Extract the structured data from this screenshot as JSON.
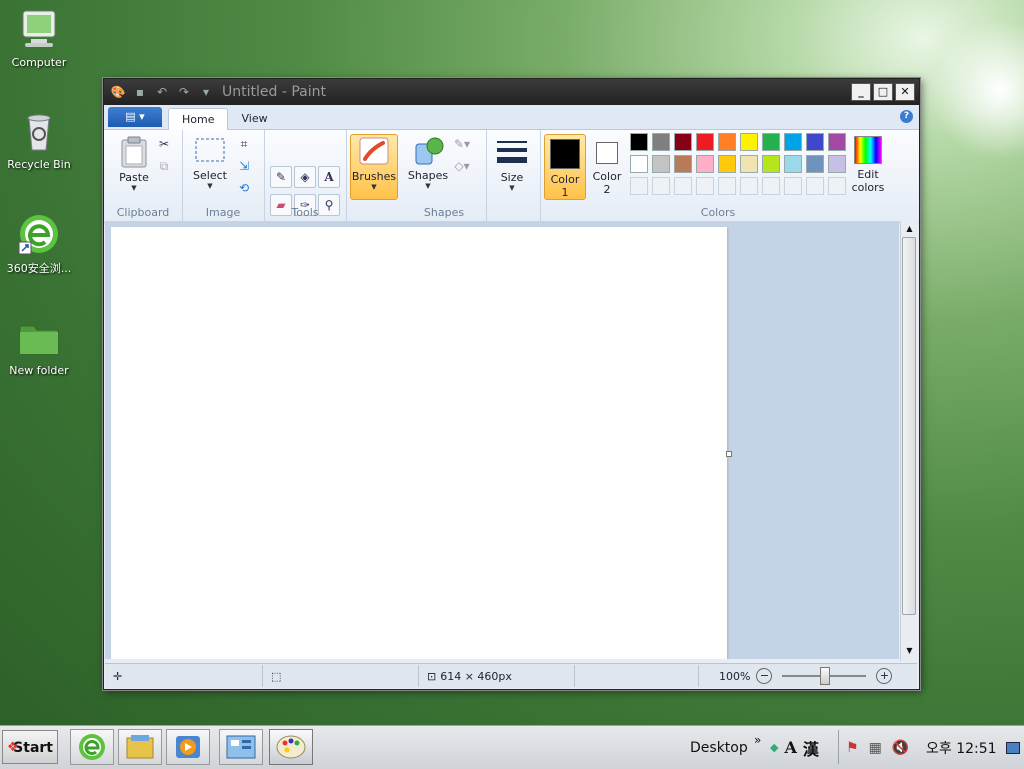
{
  "desktop": {
    "icons": [
      {
        "label": "Computer"
      },
      {
        "label": "Recycle Bin"
      },
      {
        "label": "360安全浏..."
      },
      {
        "label": "New folder"
      }
    ]
  },
  "window": {
    "title": "Untitled - Paint",
    "controls": {
      "minimize": "_",
      "maximize": "□",
      "close": "✕"
    }
  },
  "ribbon": {
    "tabs": [
      {
        "label": "Home"
      },
      {
        "label": "View"
      }
    ],
    "groups": {
      "clipboard": {
        "label": "Clipboard",
        "paste": "Paste"
      },
      "image": {
        "label": "Image",
        "select": "Select"
      },
      "tools": {
        "label": "Tools"
      },
      "brushes": {
        "label": "Brushes"
      },
      "shapes": {
        "label": "Shapes",
        "shapes_button": "Shapes"
      },
      "size": {
        "label": "Size"
      },
      "colors": {
        "label": "Colors",
        "color1": "Color",
        "color1_num": "1",
        "color2": "Color",
        "color2_num": "2",
        "edit": "Edit",
        "edit2": "colors",
        "color1_value": "#000000",
        "color2_value": "#ffffff",
        "palette_row1": [
          "#000000",
          "#7f7f7f",
          "#880015",
          "#ed1c24",
          "#ff7f27",
          "#fff200",
          "#22b14c",
          "#00a2e8",
          "#3f48cc",
          "#a349a4"
        ],
        "palette_row2": [
          "#ffffff",
          "#c3c3c3",
          "#b97a57",
          "#ffaec9",
          "#ffc90e",
          "#efe4b0",
          "#b5e61d",
          "#99d9ea",
          "#7092be",
          "#c8bfe7"
        ]
      }
    }
  },
  "statusbar": {
    "size": "614 × 460px",
    "zoom": "100%"
  },
  "taskbar": {
    "start": "Start",
    "desktop_label": "Desktop",
    "overflow": "»",
    "ime_a": "A",
    "ime_han": "漢",
    "clock": "오후 12:51"
  }
}
